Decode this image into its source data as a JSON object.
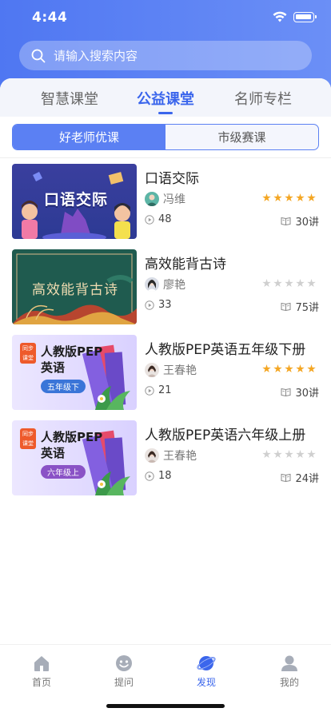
{
  "status_bar": {
    "time": "4:44"
  },
  "search": {
    "placeholder": "请输入搜索内容"
  },
  "tabs": [
    {
      "label": "智慧课堂",
      "active": false
    },
    {
      "label": "公益课堂",
      "active": true
    },
    {
      "label": "名师专栏",
      "active": false
    }
  ],
  "segment": {
    "left": "好老师优课",
    "right": "市级赛课",
    "selected": "好老师优课"
  },
  "courses": [
    {
      "title": "口语交际",
      "teacher": "冯维",
      "rating": 5,
      "plays": "48",
      "lessons": "30讲",
      "thumb_text": "口语交际"
    },
    {
      "title": "高效能背古诗",
      "teacher": "廖艳",
      "rating": 0,
      "plays": "33",
      "lessons": "75讲",
      "thumb_text": "高效能背古诗"
    },
    {
      "title": "人教版PEP英语五年级下册",
      "teacher": "王春艳",
      "rating": 5,
      "plays": "21",
      "lessons": "30讲",
      "thumb_badge": "同步课堂",
      "thumb_line1": "人教版PEP",
      "thumb_line2": "英语",
      "thumb_tag": "五年级下"
    },
    {
      "title": "人教版PEP英语六年级上册",
      "teacher": "王春艳",
      "rating": 0,
      "plays": "18",
      "lessons": "24讲",
      "thumb_badge": "同步课堂",
      "thumb_line1": "人教版PEP",
      "thumb_line2": "英语",
      "thumb_tag": "六年级上"
    }
  ],
  "tabbar": [
    {
      "label": "首页",
      "icon": "home-icon",
      "active": false
    },
    {
      "label": "提问",
      "icon": "ask-icon",
      "active": false
    },
    {
      "label": "发现",
      "icon": "discover-icon",
      "active": true
    },
    {
      "label": "我的",
      "icon": "profile-icon",
      "active": false
    }
  ],
  "colors": {
    "primary": "#3b66ec",
    "header": "#5a82f4",
    "star": "#f4a623"
  }
}
